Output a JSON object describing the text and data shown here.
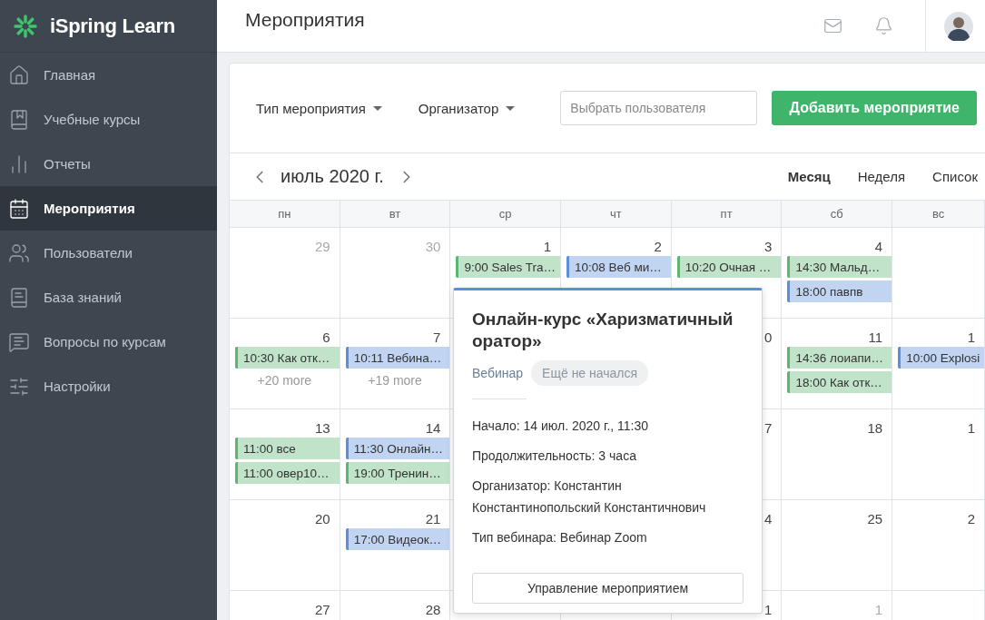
{
  "sidebar": {
    "logo": "iSpring Learn",
    "items": [
      {
        "label": "Главная",
        "selected": false
      },
      {
        "label": "Учебные курсы",
        "selected": false
      },
      {
        "label": "Отчеты",
        "selected": false
      },
      {
        "label": "Мероприятия",
        "selected": true
      },
      {
        "label": "Пользователи",
        "selected": false
      },
      {
        "label": "База знаний",
        "selected": false
      },
      {
        "label": "Вопросы по курсам",
        "selected": false
      },
      {
        "label": "Настройки",
        "selected": false
      }
    ]
  },
  "header": {
    "title": "Мероприятия"
  },
  "toolbar": {
    "filters": [
      {
        "label": "Тип мероприятия"
      },
      {
        "label": "Организатор"
      }
    ],
    "search": {
      "placeholder": "Выбрать пользователя"
    },
    "add_button": "Добавить мероприятие"
  },
  "calendar": {
    "month": "июль 2020 г.",
    "views": [
      {
        "label": "Месяц",
        "selected": true
      },
      {
        "label": "Неделя",
        "selected": false
      },
      {
        "label": "Список",
        "selected": false
      }
    ],
    "weekdays": [
      "пн",
      "вт",
      "ср",
      "чт",
      "пт",
      "сб",
      "вс"
    ],
    "weeks": [
      {
        "mon": {
          "day": "29",
          "other_month": true
        },
        "tue": {
          "day": "30",
          "other_month": true
        },
        "wed": {
          "day": "1",
          "other_month": false,
          "events": [
            {
              "title": "9:00 Sales Tra…",
              "color": "#5cb574"
            }
          ]
        },
        "thu": {
          "day": "2",
          "other_month": false,
          "events": [
            {
              "title": "10:08 Веб ми…",
              "color": "#5b8edb"
            }
          ]
        },
        "fri": {
          "day": "3",
          "other_month": false,
          "events": [
            {
              "title": "10:20 Очная …",
              "color": "#5cb574"
            }
          ]
        },
        "sat": {
          "day": "4",
          "other_month": false,
          "events": [
            {
              "title": "14:30 Мальд…",
              "color": "#5cb574"
            },
            {
              "title": "18:00 павпв",
              "color": "#5b8edb"
            }
          ]
        }
      },
      {
        "mon": {
          "day": "6",
          "other_month": false,
          "events": [
            {
              "title": "10:30 Как отк…",
              "color": "#5cb574"
            }
          ],
          "more": "+20 more"
        },
        "tue": {
          "day": "7",
          "other_month": false,
          "events": [
            {
              "title": "10:11 Вебина…",
              "color": "#5b8edb"
            }
          ],
          "more": "+19 more"
        },
        "fri": {
          "day": "0",
          "other_month": false
        },
        "sat": {
          "day": "11",
          "other_month": false,
          "events": [
            {
              "title": "14:36 лоиапи…",
              "color": "#5cb574"
            },
            {
              "title": "18:00 Как отк…",
              "color": "#5cb574"
            }
          ]
        },
        "sun": {
          "day": "1",
          "other_month": false,
          "events": [
            {
              "title": "10:00 Explosi",
              "color": "#5b8edb"
            }
          ]
        }
      },
      {
        "mon": {
          "day": "13",
          "other_month": false,
          "events": [
            {
              "title": "11:00 все",
              "color": "#5cb574"
            },
            {
              "title": "11:00 овер10…",
              "color": "#5cb574"
            }
          ]
        },
        "tue": {
          "day": "14",
          "other_month": false,
          "events": [
            {
              "title": "11:30 Онлайн…",
              "color": "#5b8edb"
            },
            {
              "title": "19:00 Тренин…",
              "color": "#5cb574"
            }
          ]
        },
        "fri": {
          "day": "7",
          "other_month": false
        },
        "sat": {
          "day": "18",
          "other_month": false
        },
        "sun": {
          "day": "1",
          "other_month": false
        }
      },
      {
        "mon": {
          "day": "20",
          "other_month": false
        },
        "tue": {
          "day": "21",
          "other_month": false,
          "events": [
            {
              "title": "17:00 Видеок…",
              "color": "#5b8edb"
            }
          ]
        },
        "fri": {
          "day": "4",
          "other_month": false
        },
        "sat": {
          "day": "25",
          "other_month": false
        },
        "sun": {
          "day": "2",
          "other_month": false
        }
      },
      {
        "mon": {
          "day": "27",
          "other_month": false
        },
        "tue": {
          "day": "28",
          "other_month": false
        },
        "fri": {
          "day": "1",
          "other_month": false
        },
        "sat": {
          "day": "1",
          "other_month": true
        }
      }
    ]
  },
  "popover": {
    "title": "Онлайн-курс «Харизматичный оратор»",
    "type": "Вебинар",
    "status": "Ещё не начался",
    "details": [
      "Начало: 14 июл. 2020 г., 11:30",
      "Продолжительность: 3 часа",
      "Организатор: Константин Константинопольский Константичнович",
      "Тип вебинара: Вебинар Zoom"
    ],
    "action": "Управление мероприятием"
  }
}
